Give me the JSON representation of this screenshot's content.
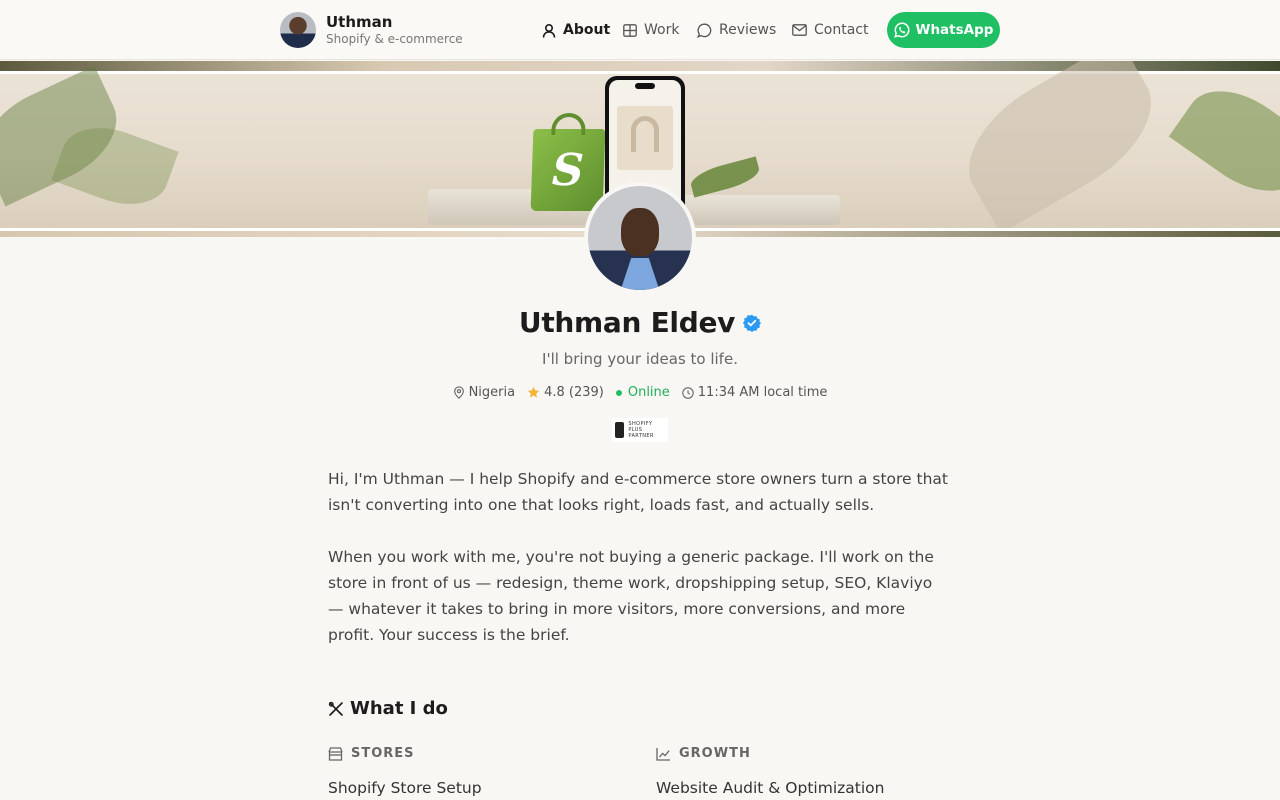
{
  "header": {
    "name": "Uthman",
    "subtitle": "Shopify & e-commerce",
    "nav": [
      {
        "label": "About",
        "icon": "user-icon",
        "active": true
      },
      {
        "label": "Work",
        "icon": "grid-icon",
        "active": false
      },
      {
        "label": "Reviews",
        "icon": "chat-bubble-icon",
        "active": false
      },
      {
        "label": "Contact",
        "icon": "mail-icon",
        "active": false
      }
    ],
    "cta_label": "WhatsApp"
  },
  "profile": {
    "name": "Uthman Eldev",
    "tagline": "I'll bring your ideas to life.",
    "location": "Nigeria",
    "rating": "4.8 (239)",
    "status": "Online",
    "local_time": "11:34 AM local time",
    "badge_text": "SHOPIFY PLUS PARTNER"
  },
  "bio": {
    "paragraphs": [
      "Hi, I'm Uthman — I help Shopify and e-commerce store owners turn a store that isn't converting into one that looks right, loads fast, and actually sells.",
      "When you work with me, you're not buying a generic package. I'll work on the store in front of us — redesign, theme work, dropshipping setup, SEO, Klaviyo — whatever it takes to bring in more visitors, more conversions, and more profit. Your success is the brief."
    ]
  },
  "what_i_do": {
    "title": "What I do",
    "categories": [
      {
        "label": "STORES",
        "icon": "store-icon",
        "first_item": "Shopify Store Setup"
      },
      {
        "label": "GROWTH",
        "icon": "chart-icon",
        "first_item": "Website Audit & Optimization"
      }
    ]
  },
  "colors": {
    "accent_green": "#1fbf63",
    "verified_blue": "#2b9af3",
    "star": "#f2b53a",
    "background": "#f8f7f4"
  }
}
